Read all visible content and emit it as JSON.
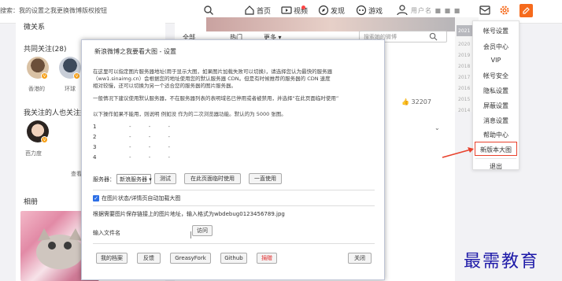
{
  "topbar": {
    "search_text": "搜索：我的设置之我更换微博版权按钮",
    "nav": [
      {
        "label": "首页",
        "icon": "home-icon"
      },
      {
        "label": "视频",
        "icon": "video-icon"
      },
      {
        "label": "发现",
        "icon": "compass-icon"
      },
      {
        "label": "游戏",
        "icon": "gamepad-icon"
      }
    ],
    "user_name": "用户名 ■ ■ ■"
  },
  "left": {
    "section_top": "微关系",
    "common_follow": "共同关注(28)",
    "common_users": [
      "香港的",
      "环球"
    ],
    "also_follow": "我关注的人也关注她",
    "also_users": [
      "芭力度"
    ],
    "more_link": "查看",
    "album_title": "相册"
  },
  "center": {
    "tab_all": "全部",
    "tab_hot": "热门",
    "tab_more": "更多 ▾",
    "search_placeholder": "搜索她的微博",
    "like_count": "32207"
  },
  "right": {
    "years": [
      "2021",
      "2020",
      "2019",
      "2018",
      "2017",
      "2016",
      "2015",
      "2014"
    ]
  },
  "menu": {
    "items": [
      "帐号设置",
      "会员中心",
      "VIP",
      "帐号安全",
      "隐私设置",
      "屏蔽设置",
      "消息设置",
      "帮助中心",
      "新版本大图"
    ],
    "logout": "退出"
  },
  "modal": {
    "title": "新浪微博之我要看大图 - 设置",
    "para1": [
      "在这里可以指定图片服务器地址(用于显示大图，如果图片加载失败可以切换)，请选择您认为最快的服务器",
      "（ww1.sinaimg.cn）会根据您的地址使用您的默认服务器 CDN。但是有时候推荐的服务器的 CDN 速度",
      "相对较慢，还可以切换为另一个适合您的服务器的图片服务器。"
    ],
    "para2": "一般情况下建议使用默认服务器，不在服务器列表的表明域名已停用或者被禁用，并选择“在此页面临时使用”",
    "para3": "以下操作如果不能用，则说明 例如没 作为的二次浏览器功能。默认的为 5000 张图。",
    "rows": [
      "1",
      "2",
      "3",
      "4"
    ],
    "server_label": "服务器：",
    "server_value": "新浪服务器",
    "btn_test": "测试",
    "btn_temp": "在此页面临时使用",
    "btn_always": "一直使用",
    "checkbox_label": "在图片状态/详情页自动加载大图",
    "filename_hint": "根据需要图片保存链接上的图片地址，输入格式为wbdebug0123456789.jpg",
    "input_label": "输入文件名",
    "btn_query": "访问",
    "footer_buttons": [
      "我的档案",
      "反馈",
      "GreasyFork",
      "Github"
    ],
    "footer_red": "捐赠",
    "btn_close": "关闭"
  },
  "watermark": "最需教育",
  "colors": {
    "accent": "#f66a1c",
    "highlight": "#e8412c",
    "watermark": "#1e1aa8",
    "checkbox": "#2d6fe6"
  }
}
